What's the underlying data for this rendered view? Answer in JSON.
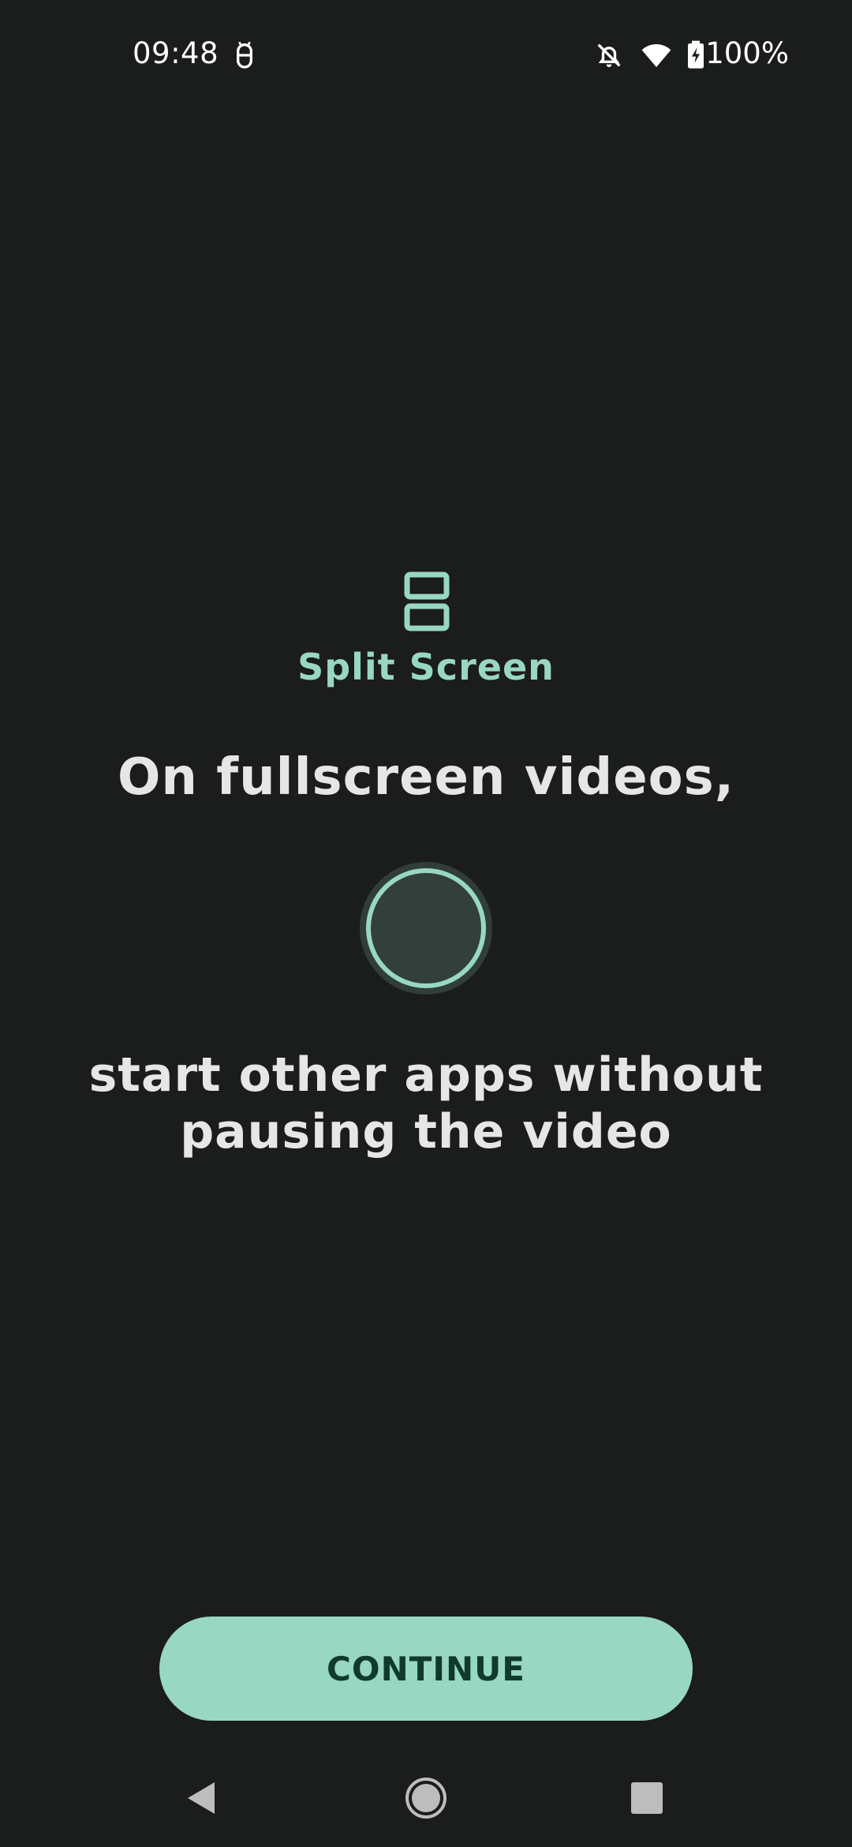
{
  "status_bar": {
    "time": "09:48",
    "battery": "100%",
    "icons": [
      "android-debug-icon",
      "notifications-off-icon",
      "wifi-icon",
      "battery-charging-icon"
    ]
  },
  "onboarding": {
    "feature_icon": "split-screen-icon",
    "feature_label": "Split Screen",
    "headline": "On fullscreen videos,",
    "subline": "start other apps without pausing the video"
  },
  "actions": {
    "continue_label": "CONTINUE"
  },
  "nav_bar": {
    "icons": [
      "back-icon",
      "home-icon",
      "recents-icon"
    ]
  },
  "colors": {
    "background": "#1b1c1c",
    "accent": "#98d7c1",
    "button_text": "#0f3a2c",
    "text": "#e6e6e6"
  }
}
